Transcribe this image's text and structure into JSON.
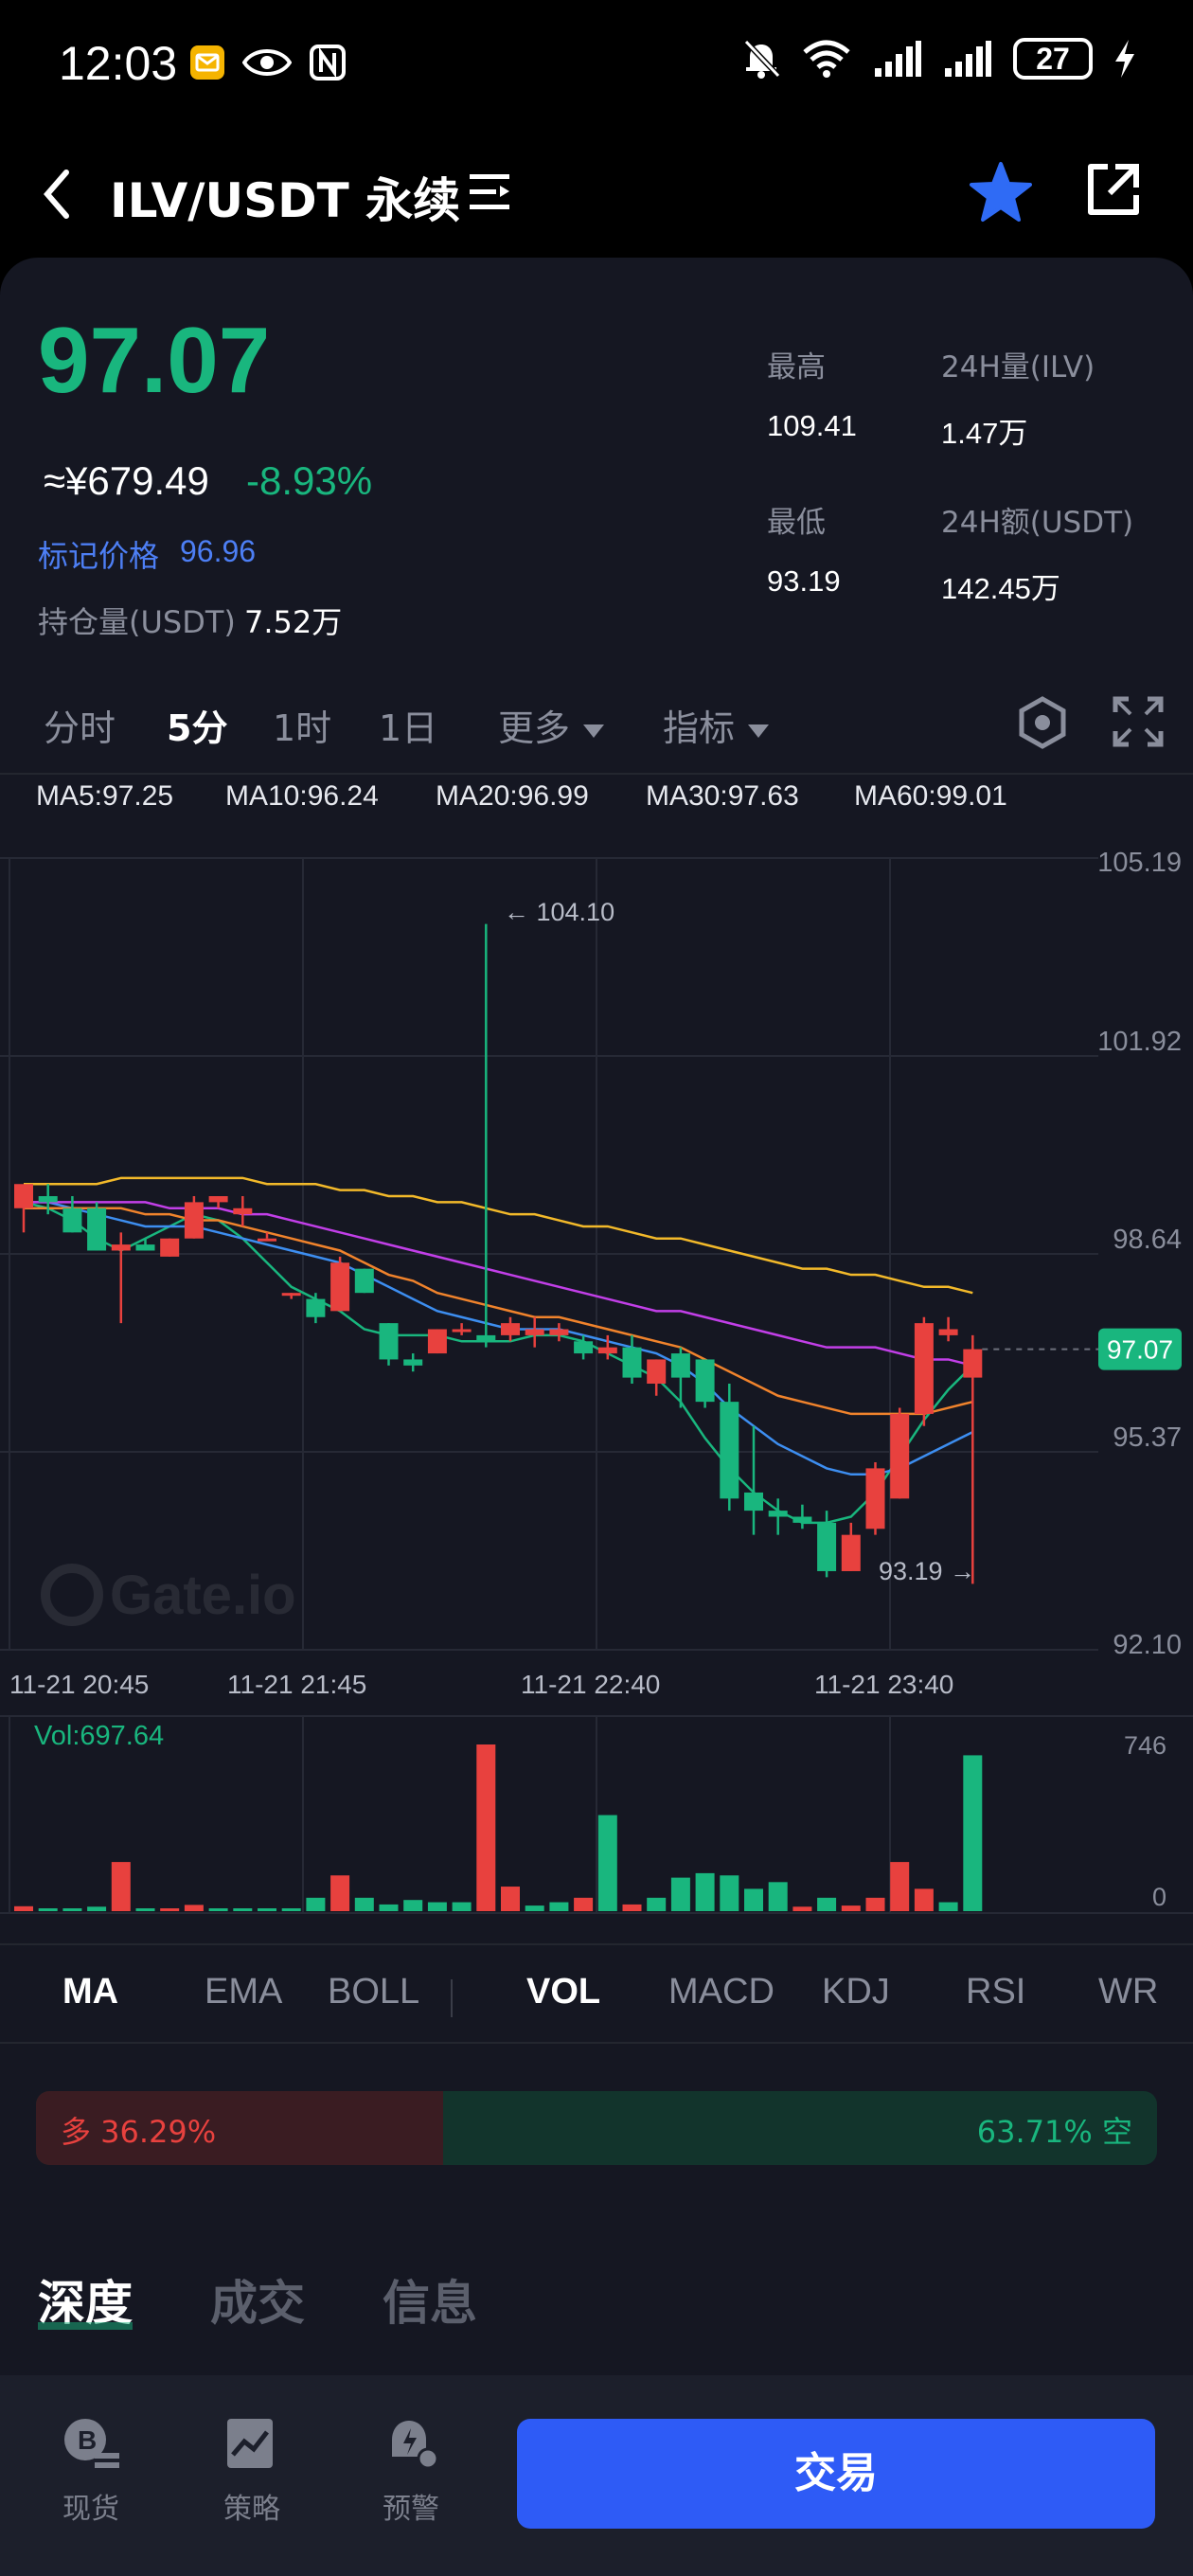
{
  "status_bar": {
    "time": "12:03",
    "battery": "27"
  },
  "header": {
    "pair": "ILV/USDT 永续"
  },
  "ticker": {
    "last_price": "97.07",
    "cny_price": "≈¥679.49",
    "change_pct": "-8.93%",
    "mark_label": "标记价格",
    "mark_value": "96.96",
    "oi_label": "持仓量(USDT)",
    "oi_value": "7.52万",
    "high_label": "最高",
    "high_value": "109.41",
    "low_label": "最低",
    "low_value": "93.19",
    "vol_label": "24H量(ILV)",
    "vol_value": "1.47万",
    "amt_label": "24H额(USDT)",
    "amt_value": "142.45万"
  },
  "intervals": [
    "分时",
    "5分",
    "1时",
    "1日",
    "更多",
    "指标"
  ],
  "active_interval": "5分",
  "ma_legend": [
    {
      "label": "MA5:97.25",
      "color": "#19b67e"
    },
    {
      "label": "MA10:96.24",
      "color": "#3d8ef0"
    },
    {
      "label": "MA20:96.99",
      "color": "#f0832c"
    },
    {
      "label": "MA30:97.63",
      "color": "#c23fe8"
    },
    {
      "label": "MA60:99.01",
      "color": "#f2b92a"
    }
  ],
  "chart_data": {
    "type": "candlestick",
    "y_ticks": [
      "105.19",
      "101.92",
      "98.64",
      "95.37",
      "92.10"
    ],
    "ylim": [
      92.1,
      105.19
    ],
    "x_ticks": [
      "11-21 20:45",
      "11-21 21:45",
      "11-21 22:40",
      "11-21 23:40"
    ],
    "high_annotation": "← 104.10",
    "low_annotation": "93.19 →",
    "current_price_tag": "97.07",
    "candles": [
      {
        "o": 99.4,
        "h": 99.7,
        "l": 99.0,
        "c": 99.8
      },
      {
        "o": 99.6,
        "h": 99.8,
        "l": 99.3,
        "c": 99.5
      },
      {
        "o": 99.4,
        "h": 99.6,
        "l": 99.0,
        "c": 99.0
      },
      {
        "o": 99.4,
        "h": 99.5,
        "l": 98.7,
        "c": 98.7
      },
      {
        "o": 98.7,
        "h": 99.0,
        "l": 97.5,
        "c": 98.8
      },
      {
        "o": 98.8,
        "h": 98.9,
        "l": 98.7,
        "c": 98.7
      },
      {
        "o": 98.6,
        "h": 98.9,
        "l": 98.6,
        "c": 98.9
      },
      {
        "o": 98.9,
        "h": 99.6,
        "l": 98.9,
        "c": 99.5
      },
      {
        "o": 99.5,
        "h": 99.6,
        "l": 99.4,
        "c": 99.6
      },
      {
        "o": 99.3,
        "h": 99.6,
        "l": 99.1,
        "c": 99.4
      },
      {
        "o": 98.9,
        "h": 99.0,
        "l": 98.9,
        "c": 98.9
      },
      {
        "o": 98.0,
        "h": 98.0,
        "l": 97.9,
        "c": 98.0
      },
      {
        "o": 97.9,
        "h": 98.0,
        "l": 97.5,
        "c": 97.6
      },
      {
        "o": 97.7,
        "h": 98.6,
        "l": 97.7,
        "c": 98.5
      },
      {
        "o": 98.4,
        "h": 98.4,
        "l": 98.0,
        "c": 98.0
      },
      {
        "o": 97.5,
        "h": 97.5,
        "l": 96.8,
        "c": 96.9
      },
      {
        "o": 96.9,
        "h": 97.0,
        "l": 96.7,
        "c": 96.8
      },
      {
        "o": 97.0,
        "h": 97.4,
        "l": 97.0,
        "c": 97.4
      },
      {
        "o": 97.4,
        "h": 97.5,
        "l": 97.3,
        "c": 97.4
      },
      {
        "o": 97.3,
        "h": 104.1,
        "l": 97.1,
        "c": 97.2
      },
      {
        "o": 97.3,
        "h": 97.6,
        "l": 97.2,
        "c": 97.5
      },
      {
        "o": 97.3,
        "h": 97.6,
        "l": 97.1,
        "c": 97.4
      },
      {
        "o": 97.3,
        "h": 97.5,
        "l": 97.2,
        "c": 97.4
      },
      {
        "o": 97.2,
        "h": 97.3,
        "l": 96.9,
        "c": 97.0
      },
      {
        "o": 97.0,
        "h": 97.3,
        "l": 96.9,
        "c": 97.1
      },
      {
        "o": 97.1,
        "h": 97.3,
        "l": 96.5,
        "c": 96.6
      },
      {
        "o": 96.5,
        "h": 96.9,
        "l": 96.3,
        "c": 96.9
      },
      {
        "o": 97.0,
        "h": 97.1,
        "l": 96.1,
        "c": 96.6
      },
      {
        "o": 96.9,
        "h": 96.9,
        "l": 96.1,
        "c": 96.2
      },
      {
        "o": 96.2,
        "h": 96.5,
        "l": 94.4,
        "c": 94.6
      },
      {
        "o": 94.7,
        "h": 95.8,
        "l": 94.0,
        "c": 94.4
      },
      {
        "o": 94.4,
        "h": 94.6,
        "l": 94.0,
        "c": 94.3
      },
      {
        "o": 94.3,
        "h": 94.5,
        "l": 94.1,
        "c": 94.2
      },
      {
        "o": 94.2,
        "h": 94.4,
        "l": 93.3,
        "c": 93.4
      },
      {
        "o": 93.4,
        "h": 94.2,
        "l": 93.4,
        "c": 94.0
      },
      {
        "o": 94.1,
        "h": 95.2,
        "l": 94.0,
        "c": 95.1
      },
      {
        "o": 94.6,
        "h": 96.1,
        "l": 94.6,
        "c": 96.0
      },
      {
        "o": 96.0,
        "h": 97.6,
        "l": 95.8,
        "c": 97.5
      },
      {
        "o": 97.3,
        "h": 97.6,
        "l": 97.2,
        "c": 97.4
      },
      {
        "o": 96.6,
        "h": 97.3,
        "l": 93.19,
        "c": 97.07
      }
    ],
    "ma_lines": {
      "MA5": [
        99.5,
        99.4,
        99.2,
        98.9,
        98.7,
        98.9,
        99.1,
        99.3,
        99.2,
        98.9,
        98.5,
        98.1,
        97.9,
        97.7,
        97.4,
        97.3,
        97.3,
        97.3,
        97.2,
        97.2,
        97.2,
        97.3,
        97.3,
        97.2,
        97.0,
        96.8,
        96.6,
        96.2,
        95.6,
        95.1,
        94.7,
        94.4,
        94.2,
        94.2,
        94.3,
        94.7,
        95.3,
        95.9,
        96.4,
        96.8
      ],
      "MA10": [
        99.5,
        99.5,
        99.4,
        99.3,
        99.2,
        99.1,
        99.1,
        99.1,
        99.0,
        98.9,
        98.8,
        98.7,
        98.6,
        98.5,
        98.3,
        98.1,
        97.9,
        97.7,
        97.6,
        97.5,
        97.4,
        97.4,
        97.4,
        97.3,
        97.2,
        97.1,
        97.0,
        96.8,
        96.5,
        96.1,
        95.8,
        95.5,
        95.3,
        95.1,
        95.0,
        95.0,
        95.1,
        95.3,
        95.5,
        95.7
      ],
      "MA20": [
        99.4,
        99.4,
        99.4,
        99.4,
        99.4,
        99.3,
        99.3,
        99.2,
        99.2,
        99.1,
        99.0,
        98.9,
        98.8,
        98.7,
        98.5,
        98.3,
        98.2,
        98.0,
        97.9,
        97.8,
        97.7,
        97.6,
        97.6,
        97.5,
        97.4,
        97.3,
        97.2,
        97.1,
        96.9,
        96.7,
        96.5,
        96.3,
        96.2,
        96.1,
        96.0,
        96.0,
        96.0,
        96.0,
        96.1,
        96.2
      ],
      "MA30": [
        99.5,
        99.5,
        99.5,
        99.5,
        99.5,
        99.5,
        99.4,
        99.4,
        99.4,
        99.3,
        99.3,
        99.2,
        99.1,
        99.0,
        98.9,
        98.8,
        98.7,
        98.6,
        98.5,
        98.4,
        98.3,
        98.2,
        98.1,
        98.0,
        97.9,
        97.8,
        97.7,
        97.7,
        97.6,
        97.5,
        97.4,
        97.3,
        97.2,
        97.1,
        97.1,
        97.1,
        97.0,
        96.9,
        96.9,
        96.8
      ],
      "MA60": [
        99.8,
        99.8,
        99.8,
        99.8,
        99.9,
        99.9,
        99.9,
        99.9,
        99.9,
        99.9,
        99.8,
        99.8,
        99.8,
        99.7,
        99.7,
        99.6,
        99.6,
        99.5,
        99.5,
        99.4,
        99.3,
        99.3,
        99.2,
        99.1,
        99.1,
        99.0,
        98.9,
        98.9,
        98.8,
        98.7,
        98.6,
        98.5,
        98.4,
        98.4,
        98.3,
        98.3,
        98.2,
        98.1,
        98.1,
        98.0
      ]
    },
    "volume": {
      "label": "Vol:697.64",
      "ylim_label_top": "746",
      "ylim_label_bottom": "0",
      "max": 746,
      "values": [
        22,
        8,
        10,
        20,
        220,
        5,
        10,
        28,
        10,
        10,
        5,
        5,
        60,
        160,
        60,
        30,
        50,
        40,
        40,
        746,
        110,
        25,
        40,
        60,
        430,
        30,
        60,
        150,
        170,
        160,
        100,
        130,
        20,
        60,
        25,
        60,
        220,
        100,
        40,
        697.64
      ],
      "up": [
        false,
        true,
        true,
        true,
        false,
        true,
        false,
        false,
        true,
        true,
        true,
        true,
        true,
        false,
        true,
        true,
        true,
        true,
        true,
        false,
        false,
        true,
        true,
        false,
        true,
        false,
        true,
        true,
        true,
        true,
        true,
        true,
        false,
        true,
        false,
        false,
        false,
        false,
        true,
        true
      ]
    }
  },
  "indicator_tabs": [
    "MA",
    "EMA",
    "BOLL",
    "VOL",
    "MACD",
    "KDJ",
    "RSI",
    "WR"
  ],
  "active_main_indicator": "MA",
  "active_sub_indicator": "VOL",
  "long_short": {
    "long": "多 36.29%",
    "short": "63.71% 空",
    "long_pct": 36.29
  },
  "bottom_tabs": [
    "深度",
    "成交",
    "信息"
  ],
  "active_bottom_tab": "深度",
  "nav": [
    {
      "label": "现货"
    },
    {
      "label": "策略"
    },
    {
      "label": "预警"
    }
  ],
  "trade_button": "交易",
  "colors": {
    "up": "#19b67e",
    "down": "#e8413e",
    "accent": "#2e5bf6",
    "bg": "#151722"
  }
}
